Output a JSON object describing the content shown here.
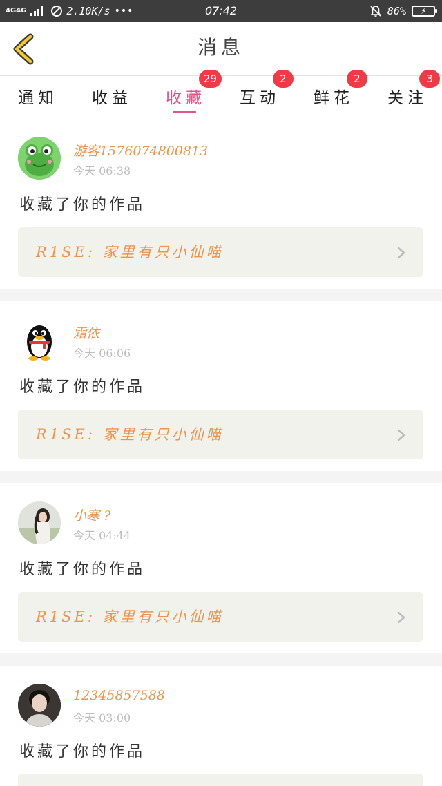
{
  "status_bar": {
    "network": "4G4G",
    "speed": "2.10K/s",
    "dots": "•••",
    "time": "07:42",
    "battery": "86%",
    "battery_level": 0.86,
    "battery_color": "#3ed36b"
  },
  "header": {
    "title": "消息",
    "back_icon": "chevron-left-icon"
  },
  "tabs": [
    {
      "label": "通知",
      "badge": ""
    },
    {
      "label": "收益",
      "badge": ""
    },
    {
      "label": "收藏",
      "badge": "29",
      "active": true
    },
    {
      "label": "互动",
      "badge": "2"
    },
    {
      "label": "鲜花",
      "badge": "2"
    },
    {
      "label": "关注",
      "badge": "3"
    }
  ],
  "accent_color": "#e8518a",
  "name_color": "#f0934a",
  "badge_color": "#f03b47",
  "messages": [
    {
      "user": "游客1576074800813",
      "time": "今天 06:38",
      "action": "收藏了你的作品",
      "work": "R1SE: 家里有只小仙喵",
      "avatar": "frog-avatar"
    },
    {
      "user": "霜依",
      "time": "今天 06:06",
      "action": "收藏了你的作品",
      "work": "R1SE: 家里有只小仙喵",
      "avatar": "penguin-avatar"
    },
    {
      "user": "小寒 ?",
      "time": "今天 04:44",
      "action": "收藏了你的作品",
      "work": "R1SE: 家里有只小仙喵",
      "avatar": "girl-photo-avatar"
    },
    {
      "user": "12345857588",
      "time": "今天 03:00",
      "action": "收藏了你的作品",
      "work": "",
      "avatar": "man-photo-avatar"
    }
  ]
}
